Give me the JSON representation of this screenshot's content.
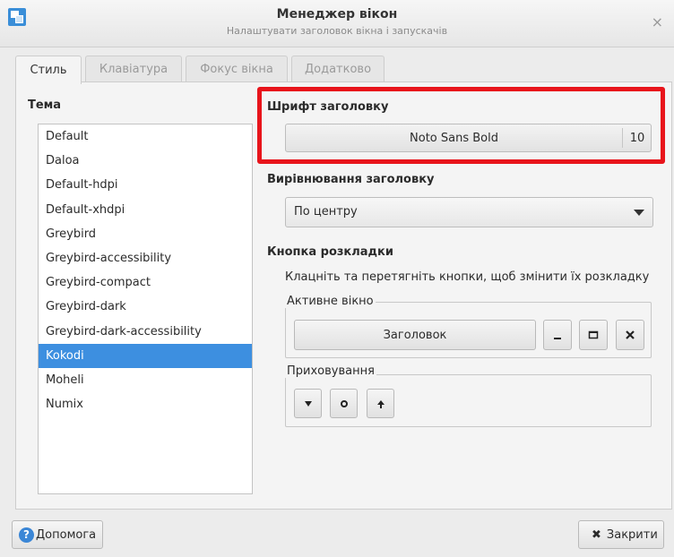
{
  "window": {
    "title": "Менеджер вікон",
    "subtitle": "Налаштувати заголовок вікна і запускачів",
    "close_glyph": "×",
    "icon": "window-manager-icon"
  },
  "tabs": [
    {
      "label": "Стиль",
      "active": true
    },
    {
      "label": "Клавіатура",
      "active": false
    },
    {
      "label": "Фокус вікна",
      "active": false
    },
    {
      "label": "Додатково",
      "active": false
    }
  ],
  "theme": {
    "heading": "Тема",
    "items": [
      "Default",
      "Daloa",
      "Default-hdpi",
      "Default-xhdpi",
      "Greybird",
      "Greybird-accessibility",
      "Greybird-compact",
      "Greybird-dark",
      "Greybird-dark-accessibility",
      "Kokodi",
      "Moheli",
      "Numix"
    ],
    "selected": "Kokodi"
  },
  "title_font": {
    "heading": "Шрифт заголовку",
    "font_name": "Noto Sans Bold",
    "font_size": "10"
  },
  "title_alignment": {
    "heading": "Вирівнювання заголовку",
    "value": "По центру"
  },
  "button_layout": {
    "heading": "Кнопка розкладки",
    "hint": "Клацніть та перетягніть кнопки, щоб змінити їх розкладку",
    "active_label": "Активне вікно",
    "title_button": "Заголовок",
    "hidden_label": "Приховування"
  },
  "footer": {
    "help": "Допомога",
    "close": "Закрити"
  },
  "colors": {
    "selection": "#3d8fe0",
    "highlight_box": "#e8141b"
  }
}
